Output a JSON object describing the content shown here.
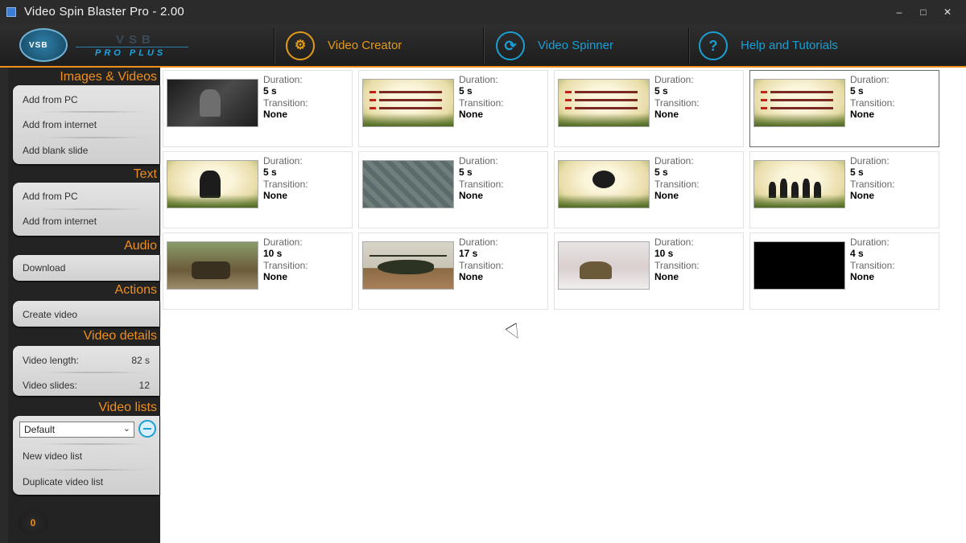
{
  "window": {
    "title": "Video Spin Blaster Pro - 2.00",
    "controls": [
      "–",
      "□",
      "✕"
    ]
  },
  "logo": {
    "badge": "VSB",
    "line1": "VSB",
    "line2": "PRO PLUS"
  },
  "nav": {
    "tabs": [
      {
        "label": "Video Creator",
        "icon": "gear-icon",
        "active": true
      },
      {
        "label": "Video Spinner",
        "icon": "refresh-icon",
        "active": false
      },
      {
        "label": "Help and Tutorials",
        "icon": "help-icon",
        "active": false
      }
    ]
  },
  "sidebar": {
    "images_videos": {
      "title": "Images & Videos",
      "items": [
        "Add from PC",
        "Add from internet",
        "Add blank slide"
      ]
    },
    "text": {
      "title": "Text",
      "items": [
        "Add from PC",
        "Add from internet"
      ]
    },
    "audio": {
      "title": "Audio",
      "items": [
        "Download"
      ]
    },
    "actions": {
      "title": "Actions",
      "items": [
        "Create video"
      ]
    },
    "video_details": {
      "title": "Video details",
      "rows": [
        {
          "label": "Video length:",
          "value": "82 s"
        },
        {
          "label": "Video slides:",
          "value": "12"
        }
      ]
    },
    "video_lists": {
      "title": "Video lists",
      "selected": "Default",
      "items": [
        "New video list",
        "Duplicate video list"
      ]
    },
    "counter": "0"
  },
  "slide_labels": {
    "duration": "Duration:",
    "transition": "Transition:"
  },
  "slides": [
    {
      "duration": "5 s",
      "transition": "None",
      "thumb": "dark-soldier"
    },
    {
      "duration": "5 s",
      "transition": "None",
      "thumb": "cream-checklist"
    },
    {
      "duration": "5 s",
      "transition": "None",
      "thumb": "cream-checklist"
    },
    {
      "duration": "5 s",
      "transition": "None",
      "thumb": "cream-checklist",
      "selected": true
    },
    {
      "duration": "5 s",
      "transition": "None",
      "thumb": "cream-soldier"
    },
    {
      "duration": "5 s",
      "transition": "None",
      "thumb": "map"
    },
    {
      "duration": "5 s",
      "transition": "None",
      "thumb": "cream-emblem"
    },
    {
      "duration": "5 s",
      "transition": "None",
      "thumb": "cream-silhouettes"
    },
    {
      "duration": "10 s",
      "transition": "None",
      "thumb": "jungle-vehicle"
    },
    {
      "duration": "17 s",
      "transition": "None",
      "thumb": "helicopter"
    },
    {
      "duration": "10 s",
      "transition": "None",
      "thumb": "snow-soldier"
    },
    {
      "duration": "4 s",
      "transition": "None",
      "thumb": "black"
    }
  ],
  "colors": {
    "accent": "#ef8f1e",
    "blue": "#1b9fd3",
    "panel": "#232323"
  }
}
